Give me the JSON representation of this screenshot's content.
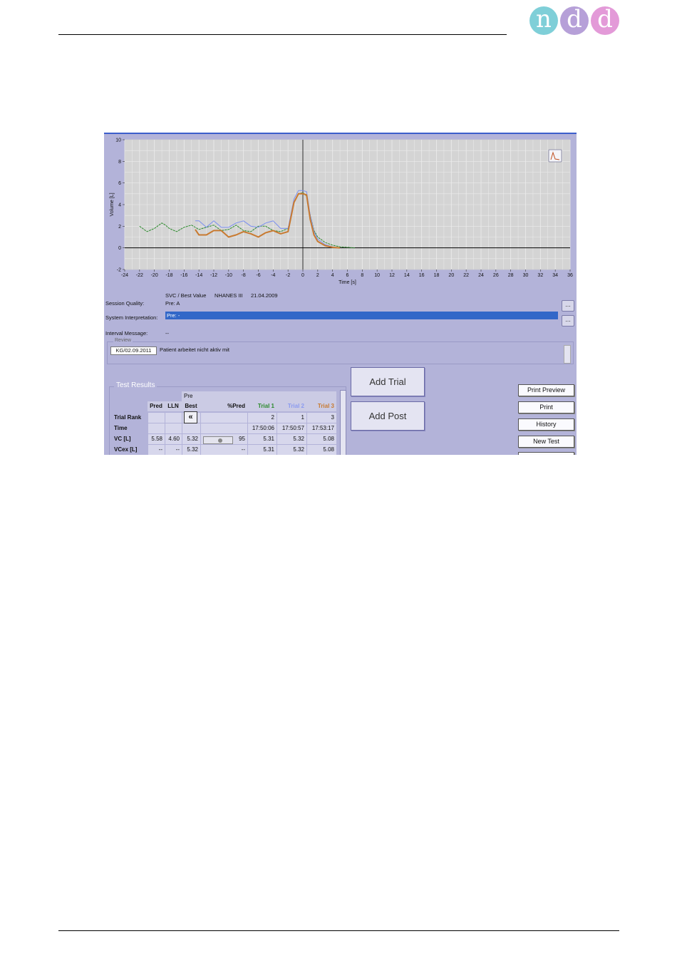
{
  "logo": {
    "letters": [
      "n",
      "d",
      "d"
    ],
    "colors": [
      "#7fcfd8",
      "#b6a0d8",
      "#e39ad8"
    ]
  },
  "chart_data": {
    "type": "line",
    "xlabel": "Time  [s]",
    "ylabel": "Volume [L]",
    "xlim": [
      -24,
      36
    ],
    "ylim": [
      -2,
      10
    ],
    "x_ticks": [
      -24,
      -22,
      -20,
      -18,
      -16,
      -14,
      -12,
      -10,
      -8,
      -6,
      -4,
      -2,
      0,
      2,
      4,
      6,
      8,
      10,
      12,
      14,
      16,
      18,
      20,
      22,
      24,
      26,
      28,
      30,
      32,
      34,
      36
    ],
    "y_ticks": [
      10,
      8,
      6,
      4,
      2,
      0,
      -2
    ],
    "grid": true,
    "series": [
      {
        "color": "#2a8a2a",
        "x": [
          -22,
          -21,
          -20,
          -19,
          -18.5,
          -18,
          -17,
          -16,
          -15,
          -14,
          -13,
          -12,
          -11,
          -10,
          -9,
          -8,
          -7,
          -6,
          -5,
          -4,
          -3,
          -2,
          -1.2,
          -0.6,
          0,
          0.5,
          1,
          1.5,
          2,
          3,
          4,
          5,
          6,
          7
        ],
        "y": [
          2.0,
          1.5,
          1.8,
          2.3,
          2.1,
          1.8,
          1.5,
          1.9,
          2.1,
          1.7,
          1.9,
          2.1,
          1.6,
          1.7,
          2.1,
          1.6,
          1.5,
          2.0,
          2.0,
          1.6,
          1.5,
          1.8,
          4.2,
          5.0,
          5.1,
          4.8,
          3.0,
          1.6,
          1.0,
          0.5,
          0.25,
          0.1,
          0.05,
          0.0
        ]
      },
      {
        "color": "#7a8ef0",
        "x": [
          -14.5,
          -14,
          -13,
          -12,
          -11,
          -10,
          -9,
          -8,
          -7,
          -6,
          -5,
          -4,
          -3,
          -2,
          -1.2,
          -0.6,
          0,
          0.5,
          1,
          1.5,
          2,
          3,
          4,
          5
        ],
        "y": [
          2.5,
          2.5,
          1.9,
          2.5,
          1.9,
          1.9,
          2.3,
          2.5,
          2.0,
          1.9,
          2.3,
          2.5,
          1.8,
          1.8,
          4.5,
          5.3,
          5.3,
          5.2,
          3.0,
          1.5,
          0.8,
          0.3,
          0.1,
          0.0
        ]
      },
      {
        "color": "#c87a30",
        "x": [
          -14.5,
          -14,
          -13,
          -12,
          -11,
          -10,
          -9,
          -8,
          -7,
          -6,
          -5,
          -4,
          -3,
          -2,
          -1.2,
          -0.6,
          0,
          0.5,
          1,
          1.5,
          2,
          3,
          4,
          5
        ],
        "y": [
          1.7,
          1.2,
          1.2,
          1.6,
          1.6,
          1.0,
          1.2,
          1.5,
          1.3,
          1.0,
          1.4,
          1.6,
          1.3,
          1.5,
          4.2,
          5.0,
          5.0,
          4.9,
          2.6,
          1.2,
          0.6,
          0.2,
          0.05,
          0.0
        ]
      }
    ]
  },
  "info": {
    "header_line": "SVC / Best Value",
    "norm": "NHANES III",
    "date": "21.04.2009",
    "session_quality_label": "Session Quality:",
    "session_quality_value": "Pre: A",
    "interpretation_label": "System Interpretation:",
    "interpretation_value": "Pre: -",
    "interval_label": "Interval Message:",
    "interval_value": "--",
    "more_btn": "..."
  },
  "review": {
    "legend": "Review",
    "date": "KG/02.09.2011",
    "text": "Patient arbeitet nicht aktiv mit"
  },
  "results": {
    "legend": "Test Results",
    "pre_label": "Pre",
    "columns": [
      "Pred",
      "LLN",
      "Best",
      "%Pred",
      "Trial 1",
      "Trial 2",
      "Trial 3"
    ],
    "trial_colors": [
      "#2a8a2a",
      "#8a9af0",
      "#c87a30"
    ],
    "rows": [
      {
        "label": "Trial Rank",
        "pred": "",
        "lln": "",
        "best": "",
        "pct": "",
        "t1": "2",
        "t2": "1",
        "t3": "3"
      },
      {
        "label": "Time",
        "pred": "",
        "lln": "",
        "best": "",
        "pct": "",
        "t1": "17:50:06",
        "t2": "17:50:57",
        "t3": "17:53:17"
      },
      {
        "label": "VC [L]",
        "pred": "5.58",
        "lln": "4.60",
        "best": "5.32",
        "pct": "95",
        "t1": "5.31",
        "t2": "5.32",
        "t3": "5.08"
      },
      {
        "label": "VCex [L]",
        "pred": "--",
        "lln": "--",
        "best": "5.32",
        "pct": "--",
        "t1": "5.31",
        "t2": "5.32",
        "t3": "5.08"
      }
    ]
  },
  "buttons": {
    "add_trial": "Add Trial",
    "add_post": "Add Post",
    "print_preview": "Print Preview",
    "print": "Print",
    "history": "History",
    "new_test": "New Test"
  }
}
